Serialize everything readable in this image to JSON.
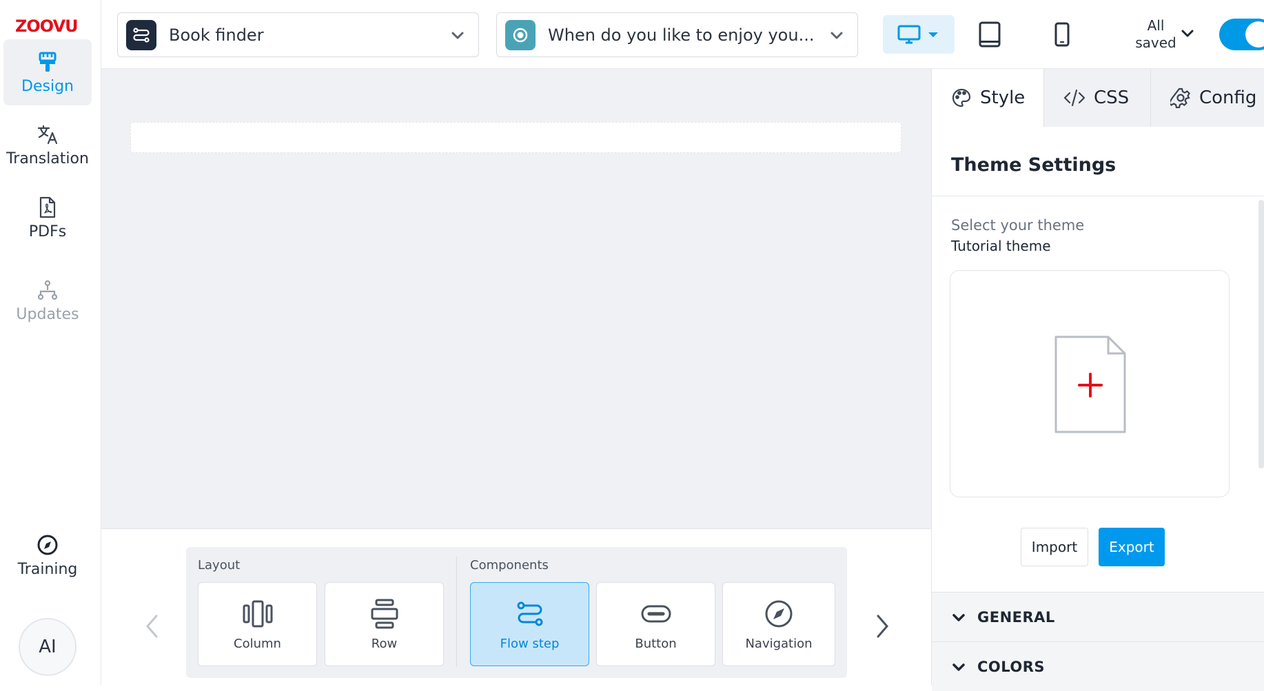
{
  "logo": "ZOOVU",
  "sidebar": {
    "items": [
      {
        "label": "Design",
        "icon": "paint-roller-icon",
        "active": true
      },
      {
        "label": "Translation",
        "icon": "translate-icon"
      },
      {
        "label": "PDFs",
        "icon": "pdf-file-icon"
      },
      {
        "label": "Updates",
        "icon": "hierarchy-icon",
        "disabled": true
      }
    ],
    "training": {
      "label": "Training",
      "icon": "compass-icon"
    },
    "ai_label": "AI"
  },
  "topbar": {
    "flow_selector": {
      "value": "Book finder",
      "icon": "flow-icon"
    },
    "step_selector": {
      "value": "When do you like to enjoy you...",
      "icon": "radio-icon"
    },
    "devices": [
      "desktop-icon",
      "tablet-icon",
      "mobile-icon"
    ],
    "save_status": {
      "line1": "All",
      "line2": "saved"
    }
  },
  "palette": {
    "layout_label": "Layout",
    "components_label": "Components",
    "layout_items": [
      {
        "label": "Column",
        "icon": "column-icon"
      },
      {
        "label": "Row",
        "icon": "row-icon"
      }
    ],
    "component_items": [
      {
        "label": "Flow step",
        "icon": "flow-step-icon",
        "active": true
      },
      {
        "label": "Button",
        "icon": "button-icon"
      },
      {
        "label": "Navigation",
        "icon": "navigation-icon"
      }
    ]
  },
  "right_panel": {
    "tabs": [
      {
        "label": "Style",
        "icon": "palette-icon",
        "active": true
      },
      {
        "label": "CSS",
        "icon": "code-icon"
      },
      {
        "label": "Config",
        "icon": "gear-icon"
      }
    ],
    "title": "Theme Settings",
    "theme_label": "Select your theme",
    "theme_name": "Tutorial theme",
    "import_label": "Import",
    "export_label": "Export",
    "sections": [
      "GENERAL",
      "COLORS"
    ]
  },
  "colors": {
    "accent": "#0099e6",
    "brand": "#e3101b",
    "canvas_bg": "#f0f1f4"
  }
}
